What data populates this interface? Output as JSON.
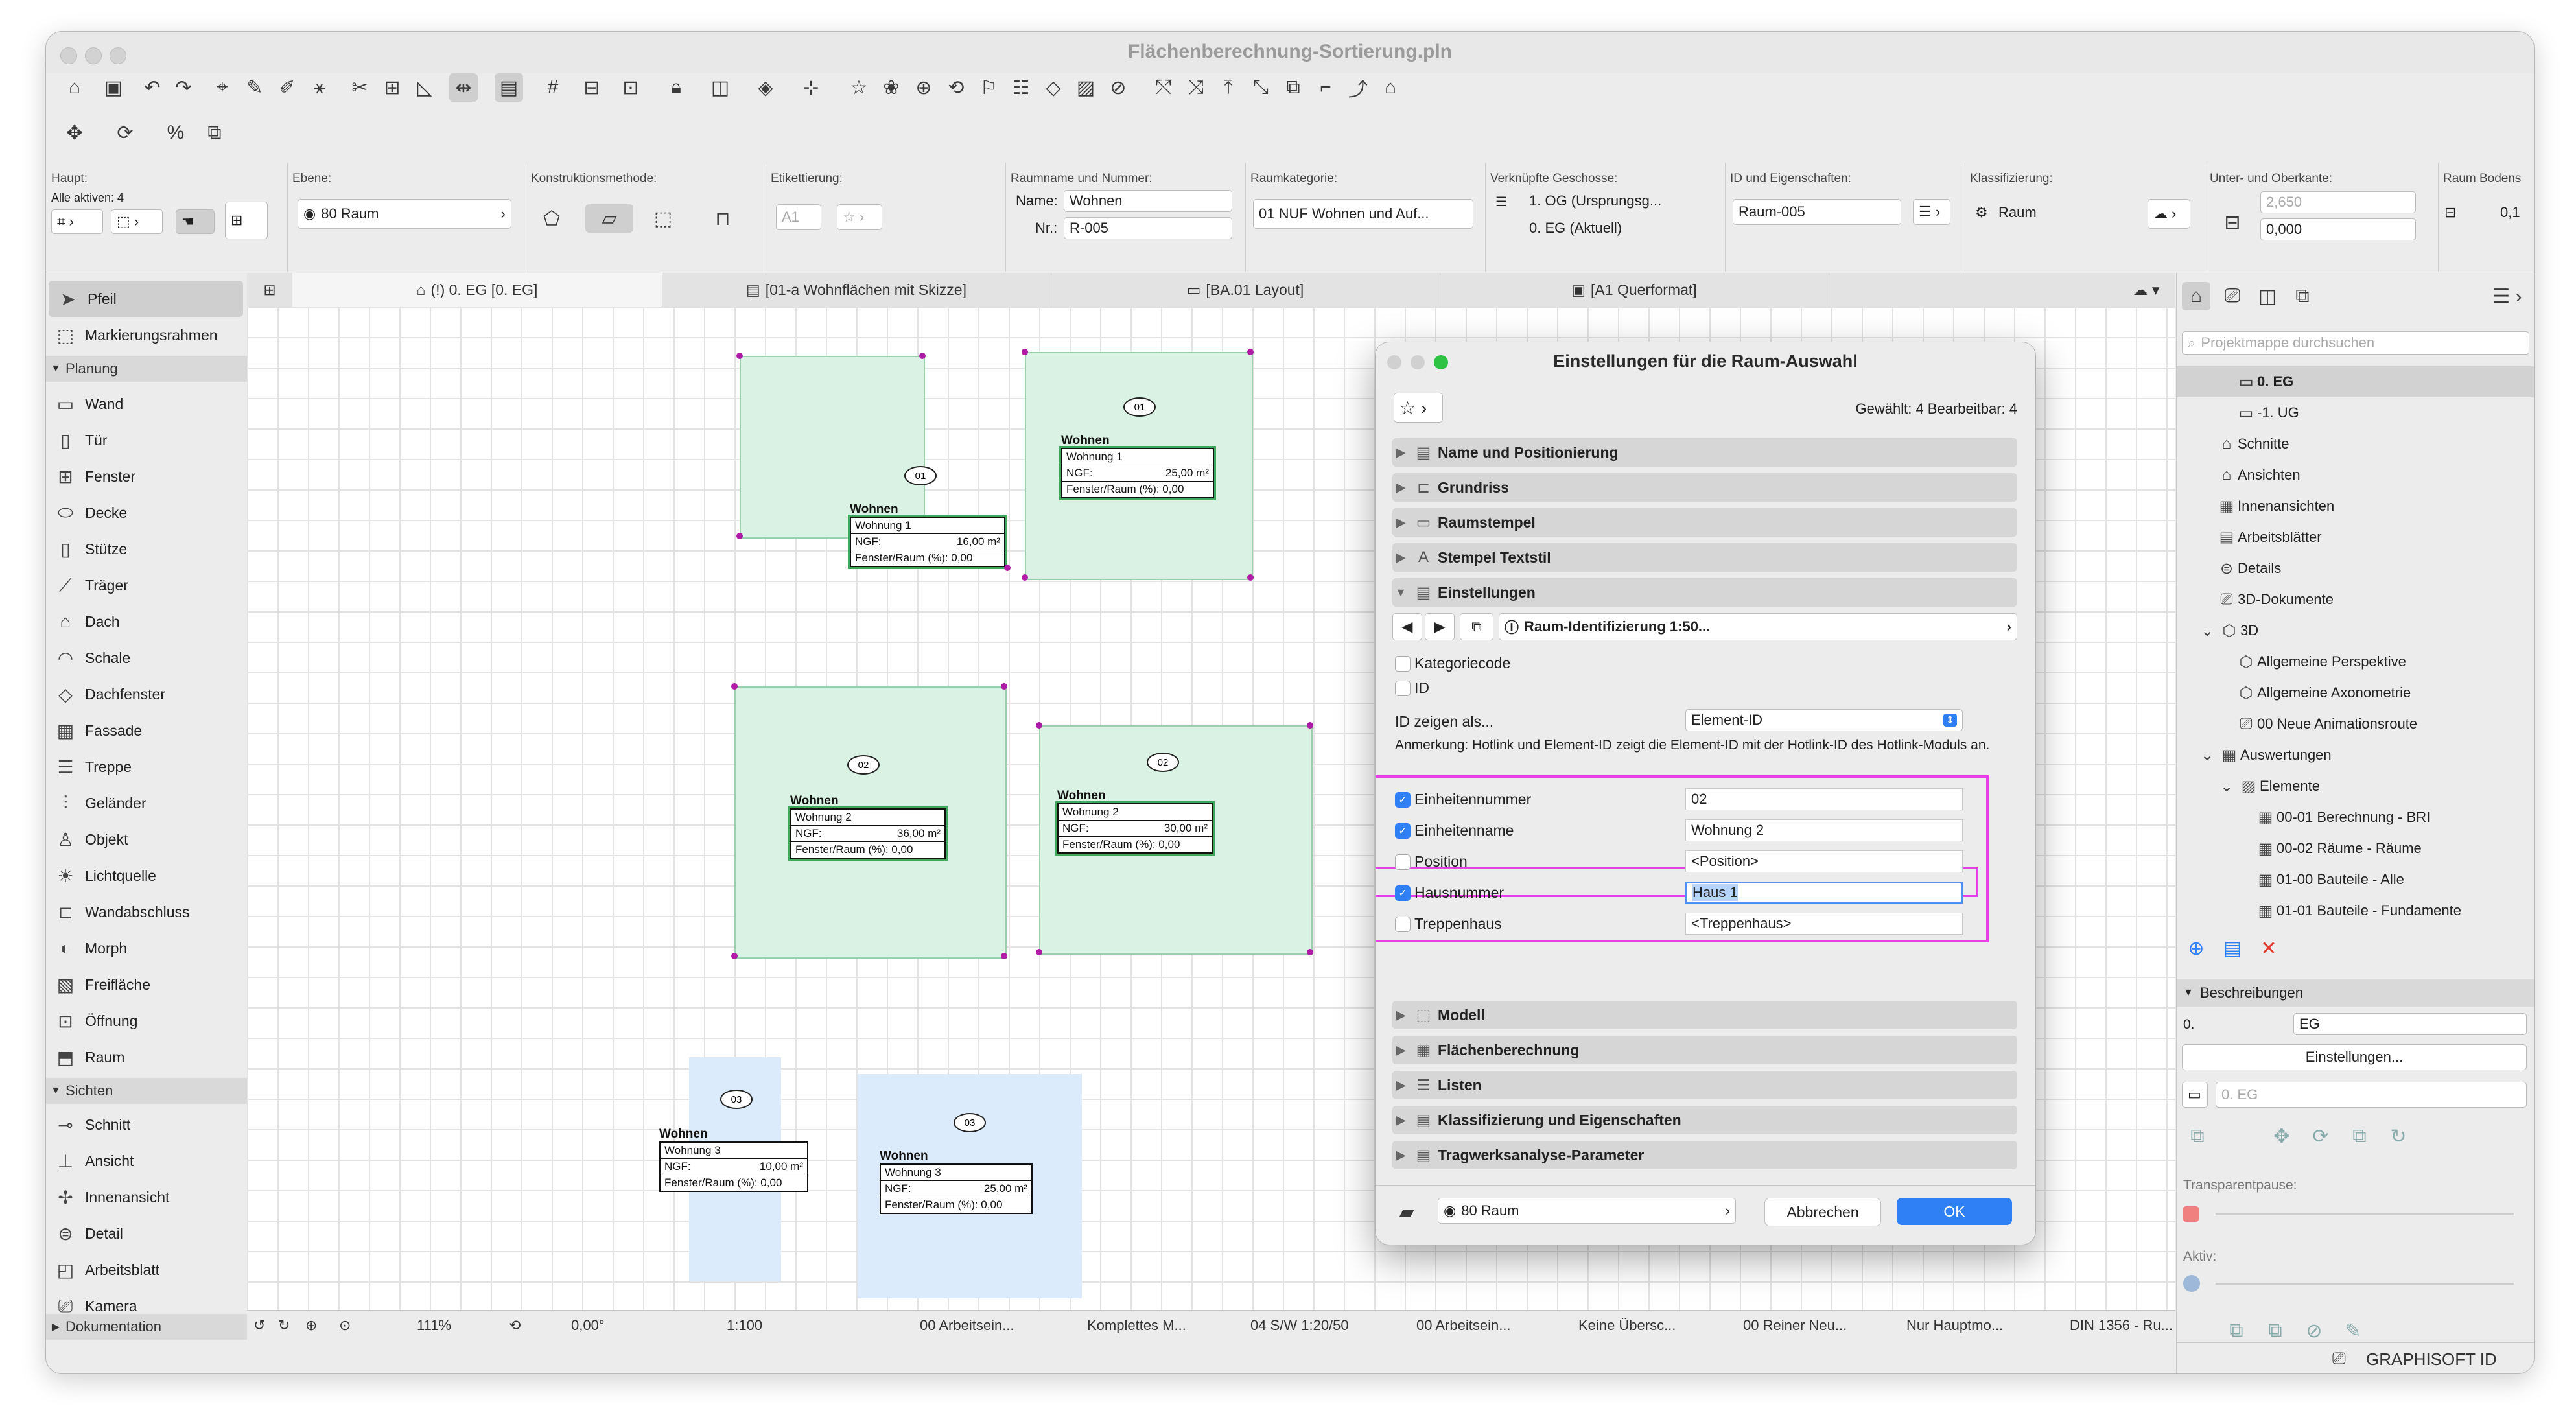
{
  "window": {
    "title": "Flächenberechnung-Sortierung.pln"
  },
  "infobar": {
    "haupt_label": "Haupt:",
    "alle_aktiven": "Alle aktiven: 4",
    "ebene_label": "Ebene:",
    "ebene_value": "80 Raum",
    "konstruktion_label": "Konstruktionsmethode:",
    "etikett_label": "Etikettierung:",
    "etikett_btn": "A1",
    "raumname_label": "Raumname und Nummer:",
    "name_label": "Name:",
    "name_value": "Wohnen",
    "nr_label": "Nr.:",
    "nr_value": "R-005",
    "raumkat_label": "Raumkategorie:",
    "raumkat_value": "01 NUF  Wohnen und Auf...",
    "geschosse_label": "Verknüpfte Geschosse:",
    "geschoss1": "1. OG (Ursprungsg...",
    "geschoss2": "0. EG (Aktuell)",
    "id_label": "ID und Eigenschaften:",
    "id_value": "Raum-005",
    "klass_label": "Klassifizierung:",
    "klass_value": "Raum",
    "unterober_label": "Unter- und Oberkante:",
    "ober_value": "2,650",
    "unter_value": "0,000",
    "raumboden_label": "Raum Bodens",
    "raumboden_value": "0,1"
  },
  "sidebar": {
    "tools_top": [
      {
        "label": "Pfeil"
      },
      {
        "label": "Markierungsrahmen"
      }
    ],
    "section_planung": "Planung",
    "planung_items": [
      {
        "label": "Wand"
      },
      {
        "label": "Tür"
      },
      {
        "label": "Fenster"
      },
      {
        "label": "Decke"
      },
      {
        "label": "Stütze"
      },
      {
        "label": "Träger"
      },
      {
        "label": "Dach"
      },
      {
        "label": "Schale"
      },
      {
        "label": "Dachfenster"
      },
      {
        "label": "Fassade"
      },
      {
        "label": "Treppe"
      },
      {
        "label": "Geländer"
      },
      {
        "label": "Objekt"
      },
      {
        "label": "Lichtquelle"
      },
      {
        "label": "Wandabschluss"
      },
      {
        "label": "Morph"
      },
      {
        "label": "Freifläche"
      },
      {
        "label": "Öffnung"
      },
      {
        "label": "Raum"
      }
    ],
    "section_sichten": "Sichten",
    "sichten_items": [
      {
        "label": "Schnitt"
      },
      {
        "label": "Ansicht"
      },
      {
        "label": "Innenansicht"
      },
      {
        "label": "Detail"
      },
      {
        "label": "Arbeitsblatt"
      },
      {
        "label": "Kamera"
      }
    ],
    "section_doku": "Dokumentation"
  },
  "tabs": [
    {
      "label": "(!) 0. EG [0. EG]"
    },
    {
      "label": "[01-a Wohnflächen mit Skizze]"
    },
    {
      "label": "[BA.01 Layout]"
    },
    {
      "label": "[A1 Querformat]"
    }
  ],
  "stamps": [
    {
      "num": "01",
      "name": "Wohnen",
      "unit": "Wohnung 1",
      "ngf_label": "NGF:",
      "ngf": "16,00 m²",
      "fenster": "Fenster/Raum (%): 0,00"
    },
    {
      "num": "01",
      "name": "Wohnen",
      "unit": "Wohnung 1",
      "ngf_label": "NGF:",
      "ngf": "25,00 m²",
      "fenster": "Fenster/Raum (%): 0,00"
    },
    {
      "num": "02",
      "name": "Wohnen",
      "unit": "Wohnung 2",
      "ngf_label": "NGF:",
      "ngf": "36,00 m²",
      "fenster": "Fenster/Raum (%): 0,00"
    },
    {
      "num": "02",
      "name": "Wohnen",
      "unit": "Wohnung 2",
      "ngf_label": "NGF:",
      "ngf": "30,00 m²",
      "fenster": "Fenster/Raum (%): 0,00"
    },
    {
      "num": "03",
      "name": "Wohnen",
      "unit": "Wohnung 3",
      "ngf_label": "NGF:",
      "ngf": "10,00 m²",
      "fenster": "Fenster/Raum (%): 0,00"
    },
    {
      "num": "03",
      "name": "Wohnen",
      "unit": "Wohnung 3",
      "ngf_label": "NGF:",
      "ngf": "25,00 m²",
      "fenster": "Fenster/Raum (%): 0,00"
    }
  ],
  "statusbar": {
    "zoom": "111%",
    "angle": "0,00°",
    "scale": "1:100",
    "s1": "00 Arbeitsein...",
    "s2": "Komplettes M...",
    "s3": "04 S/W 1:20/50",
    "s4": "00 Arbeitsein...",
    "s5": "Keine Übersc...",
    "s6": "00 Reiner Neu...",
    "s7": "Nur Hauptmo...",
    "s8": "DIN 1356 - Ru..."
  },
  "dialog": {
    "title": "Einstellungen für die Raum-Auswahl",
    "selected": "Gewählt: 4 Bearbeitbar: 4",
    "panels_top": [
      {
        "label": "Name und Positionierung"
      },
      {
        "label": "Grundriss"
      },
      {
        "label": "Raumstempel"
      },
      {
        "label": "Stempel Textstil"
      },
      {
        "label": "Einstellungen"
      }
    ],
    "stamp_selector": "Raum-Identifizierung 1:50...",
    "kategoriecode": "Kategoriecode",
    "id": "ID",
    "id_zeigen": "ID zeigen als...",
    "id_zeigen_value": "Element-ID",
    "anmerkung": "Anmerkung: Hotlink und Element-ID zeigt die Element-ID mit der Hotlink-ID des Hotlink-Moduls an.",
    "params": [
      {
        "label": "Einheitennummer",
        "value": "02",
        "checked": true
      },
      {
        "label": "Einheitenname",
        "value": "Wohnung 2",
        "checked": true
      },
      {
        "label": "Position",
        "value": "<Position>",
        "checked": false
      },
      {
        "label": "Hausnummer",
        "value": "Haus 1",
        "checked": true
      },
      {
        "label": "Treppenhaus",
        "value": "<Treppenhaus>",
        "checked": false
      }
    ],
    "panels_bottom": [
      {
        "label": "Modell"
      },
      {
        "label": "Flächenberechnung"
      },
      {
        "label": "Listen"
      },
      {
        "label": "Klassifizierung und Eigenschaften"
      },
      {
        "label": "Tragwerksanalyse-Parameter"
      }
    ],
    "layer": "80 Raum",
    "cancel": "Abbrechen",
    "ok": "OK",
    "highlight_color": "#e83ee6"
  },
  "navigator": {
    "search_placeholder": "Projektmappe durchsuchen",
    "items": [
      {
        "label": "0. EG"
      },
      {
        "label": "-1. UG"
      },
      {
        "label": "Schnitte"
      },
      {
        "label": "Ansichten"
      },
      {
        "label": "Innenansichten"
      },
      {
        "label": "Arbeitsblätter"
      },
      {
        "label": "Details"
      },
      {
        "label": "3D-Dokumente"
      },
      {
        "label": "3D"
      },
      {
        "label": "Allgemeine Perspektive"
      },
      {
        "label": "Allgemeine Axonometrie"
      },
      {
        "label": "00 Neue Animationsroute"
      },
      {
        "label": "Auswertungen"
      },
      {
        "label": "Elemente"
      },
      {
        "label": "00-01 Berechnung - BRI"
      },
      {
        "label": "00-02 Räume - Räume"
      },
      {
        "label": "01-00 Bauteile - Alle"
      },
      {
        "label": "01-01 Bauteile - Fundamente"
      }
    ],
    "beschreibungen": "Beschreibungen",
    "desc_num": "0.",
    "desc_value": "EG",
    "einstellungen_btn": "Einstellungen...",
    "eg_ref": "0. EG",
    "transparent": "Transparentpause:",
    "aktiv": "Aktiv:",
    "brand": "GRAPHISOFT ID"
  }
}
